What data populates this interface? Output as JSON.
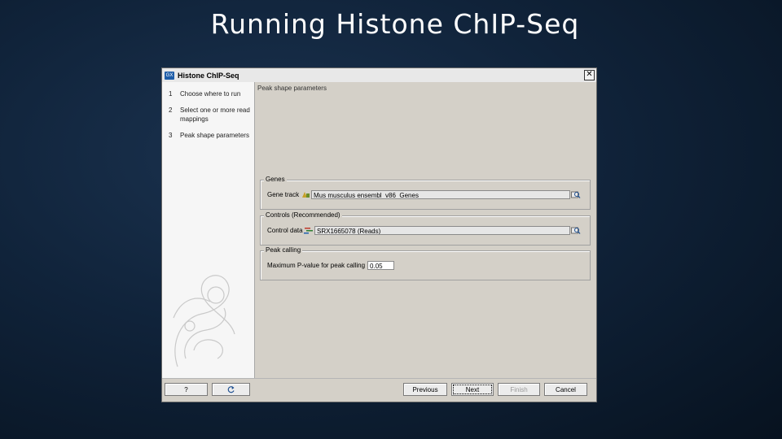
{
  "slide": {
    "title": "Running Histone ChIP-Seq"
  },
  "dialog": {
    "app_icon_text": "GX",
    "title": "Histone ChIP-Seq",
    "close_glyph": "✕",
    "steps": [
      {
        "number": "1",
        "label": "Choose where to run"
      },
      {
        "number": "2",
        "label": "Select one or more read mappings"
      },
      {
        "number": "3",
        "label": "Peak shape parameters"
      }
    ],
    "section_title": "Peak shape parameters",
    "genes": {
      "legend": "Genes",
      "label": "Gene track",
      "value": "Mus musculus ensembl_v86_Genes"
    },
    "controls": {
      "legend": "Controls (Recommended)",
      "label": "Control data",
      "value": "SRX1665078 (Reads)"
    },
    "peak_calling": {
      "legend": "Peak calling",
      "label": "Maximum P-value for peak calling",
      "value": "0.05"
    },
    "buttons": {
      "help": "?",
      "reset_icon": "reset-icon",
      "previous": "Previous",
      "next": "Next",
      "finish": "Finish",
      "cancel": "Cancel"
    }
  }
}
